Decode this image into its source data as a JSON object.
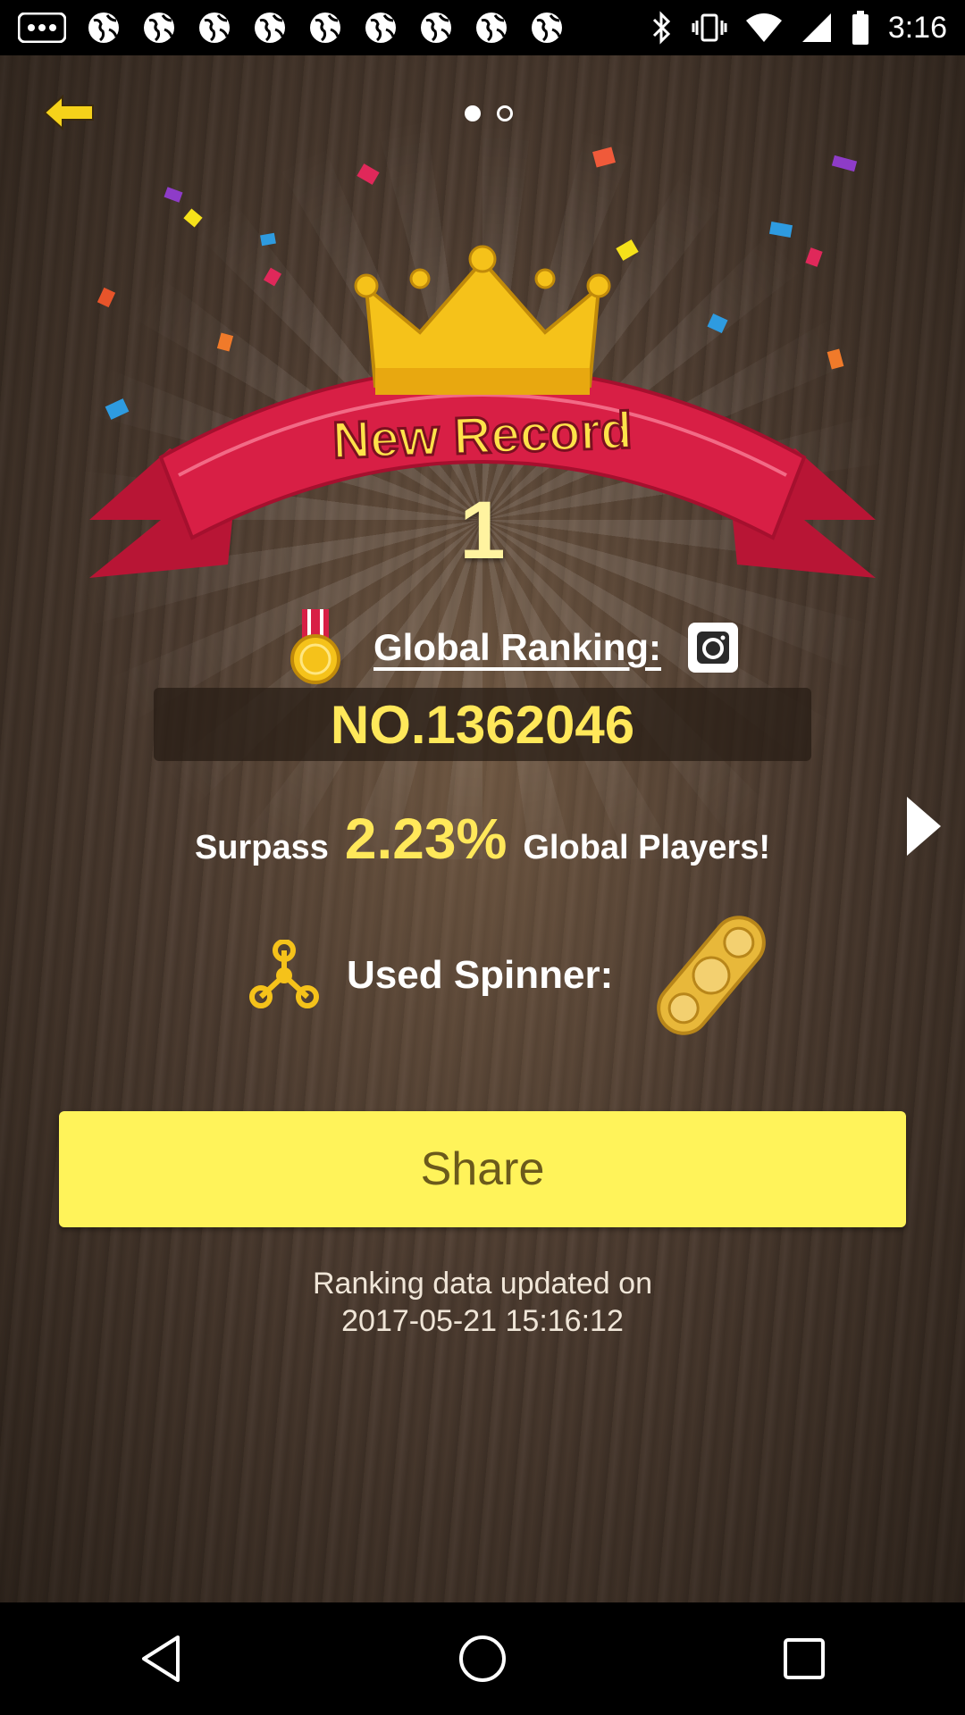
{
  "status_bar": {
    "time": "3:16",
    "icons": [
      "more-icon",
      "globe-icon",
      "globe-icon",
      "globe-icon",
      "globe-icon",
      "globe-icon",
      "globe-icon",
      "globe-icon",
      "globe-icon",
      "globe-icon",
      "bluetooth-icon",
      "vibrate-icon",
      "wifi-icon",
      "signal-icon",
      "battery-icon"
    ]
  },
  "header": {
    "back_icon": "back-arrow-icon",
    "pages": 2,
    "active_page": 1
  },
  "banner": {
    "title": "New Record",
    "record_number": "1"
  },
  "ranking": {
    "label": "Global Ranking:",
    "value": "NO.1362046"
  },
  "surpass": {
    "prefix": "Surpass",
    "percent": "2.23%",
    "suffix": "Global Players!"
  },
  "spinner": {
    "label": "Used Spinner:"
  },
  "share": {
    "label": "Share"
  },
  "updated": {
    "line1": "Ranking data updated on",
    "line2": "2017-05-21 15:16:12"
  },
  "colors": {
    "accent_yellow": "#ffe85a",
    "share_button": "#fff35a",
    "banner_red": "#d81f45",
    "crown_gold": "#f5c21a"
  },
  "nav": {
    "back": "nav-back-icon",
    "home": "nav-home-icon",
    "recents": "nav-recents-icon"
  }
}
